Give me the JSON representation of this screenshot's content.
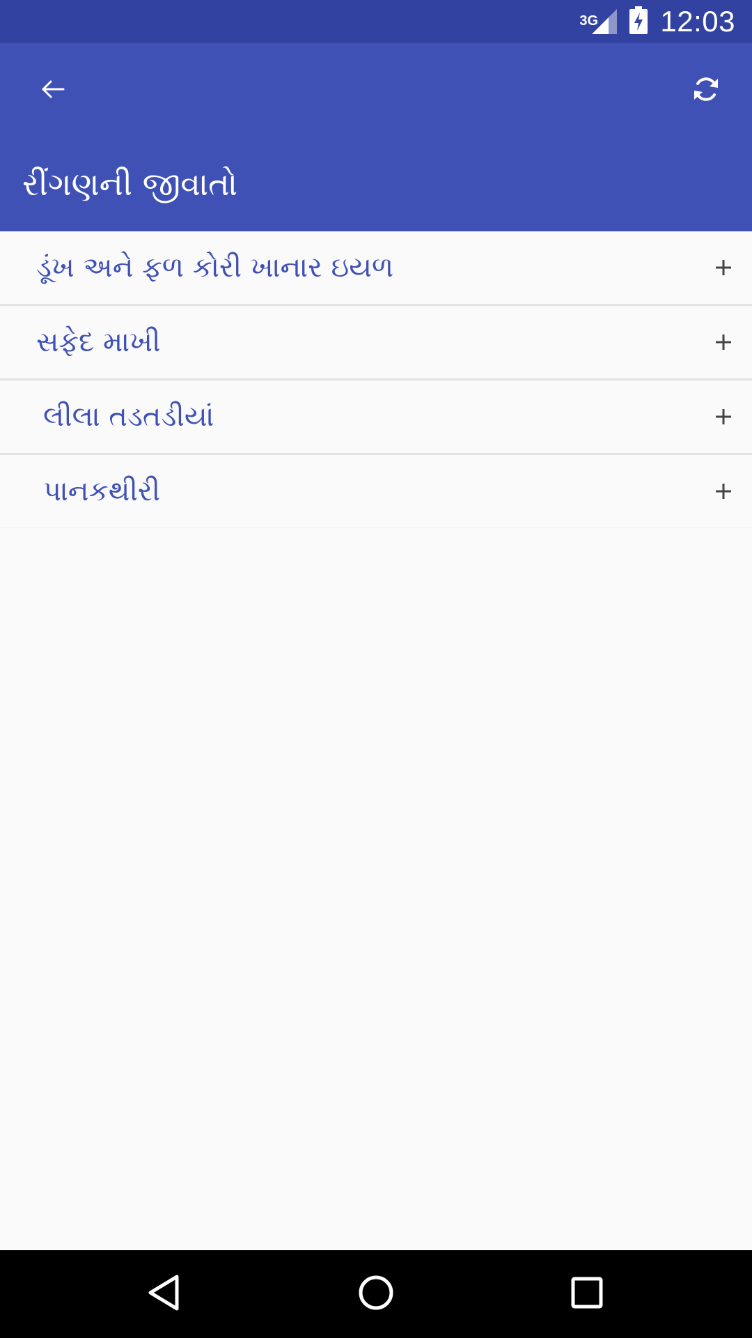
{
  "status_bar": {
    "network": "3G",
    "time": "12:03",
    "icons": [
      "signal-icon",
      "battery-charging-icon"
    ],
    "background_color": "#3142a0"
  },
  "toolbar": {
    "title": "રીંગણની જીવાતો",
    "back_icon": "arrow-back-icon",
    "refresh_icon": "refresh-icon",
    "background_color": "#3f51b5"
  },
  "list": {
    "text_color": "#3f51b5",
    "expand_icon": "plus-icon",
    "items": [
      {
        "label": "ડૂંખ અને ફળ કોરી ખાનાર ઇયળ"
      },
      {
        "label": "સફેદ માખી"
      },
      {
        "label": "લીલા તડતડીયાં"
      },
      {
        "label": "પાનકથીરી"
      }
    ]
  },
  "nav_bar": {
    "icons": [
      "back-triangle-icon",
      "home-circle-icon",
      "recents-square-icon"
    ]
  }
}
